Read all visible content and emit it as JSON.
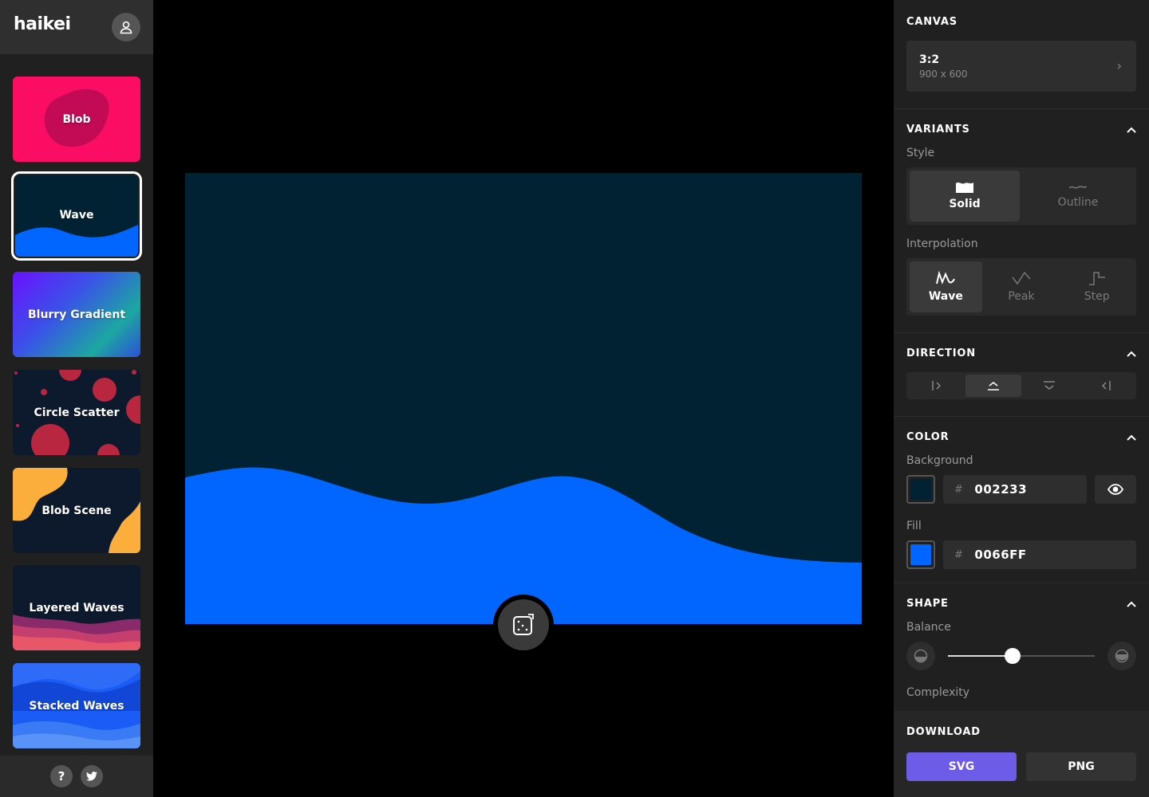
{
  "app": {
    "logo": "haikei"
  },
  "colors": {
    "background": "#002233",
    "fill": "#0066FF",
    "accent": "#6C5CE7"
  },
  "sidebar": {
    "cards": [
      {
        "label": "Blob"
      },
      {
        "label": "Wave",
        "selected": true
      },
      {
        "label": "Blurry Gradient"
      },
      {
        "label": "Circle Scatter"
      },
      {
        "label": "Blob Scene"
      },
      {
        "label": "Layered Waves"
      },
      {
        "label": "Stacked Waves"
      }
    ],
    "footer": {
      "help_label": "?",
      "twitter_icon": "twitter-icon"
    }
  },
  "panel": {
    "canvas": {
      "title": "CANVAS",
      "ratio": "3:2",
      "dims": "900 x 600"
    },
    "variants": {
      "title": "VARIANTS",
      "style_label": "Style",
      "style_options": [
        "Solid",
        "Outline"
      ],
      "style_selected": "Solid",
      "interp_label": "Interpolation",
      "interp_options": [
        "Wave",
        "Peak",
        "Step"
      ],
      "interp_selected": "Wave"
    },
    "direction": {
      "title": "DIRECTION",
      "selected_index": 1
    },
    "color": {
      "title": "COLOR",
      "background_label": "Background",
      "background_hex": "002233",
      "fill_label": "Fill",
      "fill_hex": "0066FF",
      "hash": "#"
    },
    "shape": {
      "title": "SHAPE",
      "balance_label": "Balance",
      "balance_value": 0.44,
      "complexity_label": "Complexity"
    },
    "download": {
      "title": "DOWNLOAD",
      "svg_label": "SVG",
      "png_label": "PNG"
    }
  }
}
